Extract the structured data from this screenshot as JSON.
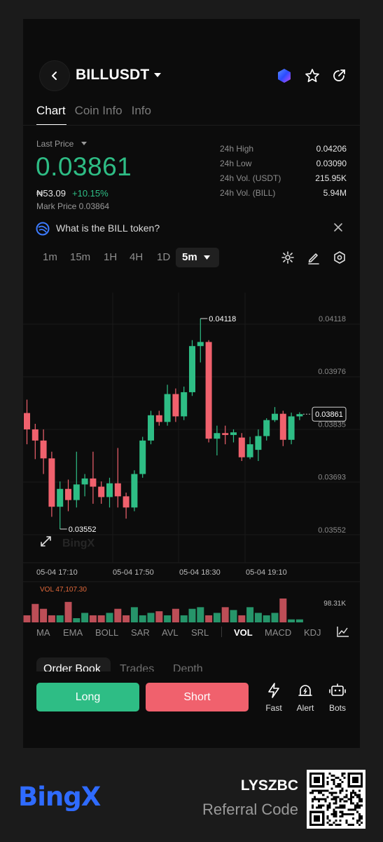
{
  "header": {
    "pair": "BILLUSDT"
  },
  "tabs": [
    "Chart",
    "Coin Info",
    "Info"
  ],
  "price": {
    "last_price_label": "Last Price",
    "last_price": "0.03861",
    "fiat": "₦53.09",
    "change": "+10.15%",
    "mark_price": "Mark Price 0.03864"
  },
  "stats": [
    {
      "label": "24h High",
      "value": "0.04206"
    },
    {
      "label": "24h Low",
      "value": "0.03090"
    },
    {
      "label": "24h Vol. (USDT)",
      "value": "215.95K"
    },
    {
      "label": "24h Vol. (BILL)",
      "value": "5.94M"
    }
  ],
  "banner": {
    "text": "What is the BILL token?"
  },
  "timeframes": [
    "1m",
    "15m",
    "1H",
    "4H",
    "1D"
  ],
  "active_timeframe": "5m",
  "chart_data": {
    "type": "candlestick",
    "y_ticks": [
      "0.04118",
      "0.03976",
      "0.03835",
      "0.03693",
      "0.03552"
    ],
    "x_ticks": [
      "05-04 17:10",
      "05-04 17:50",
      "05-04 18:30",
      "05-04 19:10"
    ],
    "high_label": "0.04118",
    "low_label": "0.03552",
    "current_price_label": "0.03861",
    "watermark": "BingX",
    "candles": [
      {
        "o": 0.03864,
        "c": 0.0382,
        "h": 0.039,
        "l": 0.0378
      },
      {
        "o": 0.0382,
        "c": 0.0379,
        "h": 0.03835,
        "l": 0.0374
      },
      {
        "o": 0.0379,
        "c": 0.03742,
        "h": 0.0382,
        "l": 0.037
      },
      {
        "o": 0.03742,
        "c": 0.03612,
        "h": 0.0376,
        "l": 0.03585
      },
      {
        "o": 0.03612,
        "c": 0.0366,
        "h": 0.0368,
        "l": 0.03552
      },
      {
        "o": 0.0366,
        "c": 0.0363,
        "h": 0.03685,
        "l": 0.036
      },
      {
        "o": 0.0363,
        "c": 0.03672,
        "h": 0.0376,
        "l": 0.0361
      },
      {
        "o": 0.03672,
        "c": 0.03688,
        "h": 0.037,
        "l": 0.0364
      },
      {
        "o": 0.03688,
        "c": 0.03666,
        "h": 0.0376,
        "l": 0.0362
      },
      {
        "o": 0.03666,
        "c": 0.03638,
        "h": 0.0368,
        "l": 0.0362
      },
      {
        "o": 0.03638,
        "c": 0.03675,
        "h": 0.0369,
        "l": 0.0361
      },
      {
        "o": 0.03675,
        "c": 0.0364,
        "h": 0.0377,
        "l": 0.0361
      },
      {
        "o": 0.0364,
        "c": 0.0361,
        "h": 0.0365,
        "l": 0.0358
      },
      {
        "o": 0.0361,
        "c": 0.037,
        "h": 0.0371,
        "l": 0.036
      },
      {
        "o": 0.037,
        "c": 0.0379,
        "h": 0.038,
        "l": 0.0369
      },
      {
        "o": 0.0379,
        "c": 0.03858,
        "h": 0.0387,
        "l": 0.0378
      },
      {
        "o": 0.03858,
        "c": 0.0384,
        "h": 0.0387,
        "l": 0.0383
      },
      {
        "o": 0.0384,
        "c": 0.03915,
        "h": 0.0394,
        "l": 0.0383
      },
      {
        "o": 0.03915,
        "c": 0.03855,
        "h": 0.0393,
        "l": 0.0384
      },
      {
        "o": 0.03855,
        "c": 0.0392,
        "h": 0.03935,
        "l": 0.03845
      },
      {
        "o": 0.0392,
        "c": 0.04044,
        "h": 0.0406,
        "l": 0.0391
      },
      {
        "o": 0.04044,
        "c": 0.04055,
        "h": 0.04118,
        "l": 0.04
      },
      {
        "o": 0.04055,
        "c": 0.03795,
        "h": 0.0406,
        "l": 0.03785
      },
      {
        "o": 0.03795,
        "c": 0.0381,
        "h": 0.0383,
        "l": 0.0375
      },
      {
        "o": 0.0381,
        "c": 0.03805,
        "h": 0.0383,
        "l": 0.0378
      },
      {
        "o": 0.03805,
        "c": 0.03812,
        "h": 0.0382,
        "l": 0.03785
      },
      {
        "o": 0.03798,
        "c": 0.03745,
        "h": 0.0381,
        "l": 0.03735
      },
      {
        "o": 0.03745,
        "c": 0.0378,
        "h": 0.038,
        "l": 0.0374
      },
      {
        "o": 0.03765,
        "c": 0.03802,
        "h": 0.0382,
        "l": 0.03735
      },
      {
        "o": 0.03802,
        "c": 0.03845,
        "h": 0.0385,
        "l": 0.0379
      },
      {
        "o": 0.03845,
        "c": 0.03862,
        "h": 0.0388,
        "l": 0.0384
      },
      {
        "o": 0.03862,
        "c": 0.03792,
        "h": 0.0387,
        "l": 0.03775
      },
      {
        "o": 0.03792,
        "c": 0.03855,
        "h": 0.03865,
        "l": 0.0378
      },
      {
        "o": 0.03855,
        "c": 0.03861,
        "h": 0.03866,
        "l": 0.03845
      }
    ],
    "volume": {
      "label": "VOL 47,107.30",
      "y_ticks": [
        "98.31K",
        "0"
      ],
      "max": 98310,
      "values": [
        57000,
        85000,
        73000,
        57000,
        57000,
        90000,
        50000,
        63000,
        57000,
        57000,
        63000,
        73000,
        57000,
        77000,
        57000,
        63000,
        67000,
        57000,
        73000,
        57000,
        73000,
        77000,
        57000,
        63000,
        77000,
        70000,
        57000,
        77000,
        63000,
        57000,
        63000,
        98310,
        47000,
        47000
      ]
    }
  },
  "indicators": [
    "MA",
    "EMA",
    "BOLL",
    "SAR",
    "AVL",
    "SRL",
    "VOL",
    "MACD",
    "KDJ"
  ],
  "active_indicator": "VOL",
  "bottom_tabs": [
    "Order Book",
    "Trades",
    "Depth"
  ],
  "actions": {
    "long": "Long",
    "short": "Short",
    "fast": "Fast",
    "alert": "Alert",
    "bots": "Bots"
  },
  "footer": {
    "brand": "BingX",
    "referral_code": "LYSZBC",
    "referral_label": "Referral Code"
  },
  "colors": {
    "up": "#2ebd85",
    "down": "#f0616d",
    "brand": "#2f6bff"
  }
}
